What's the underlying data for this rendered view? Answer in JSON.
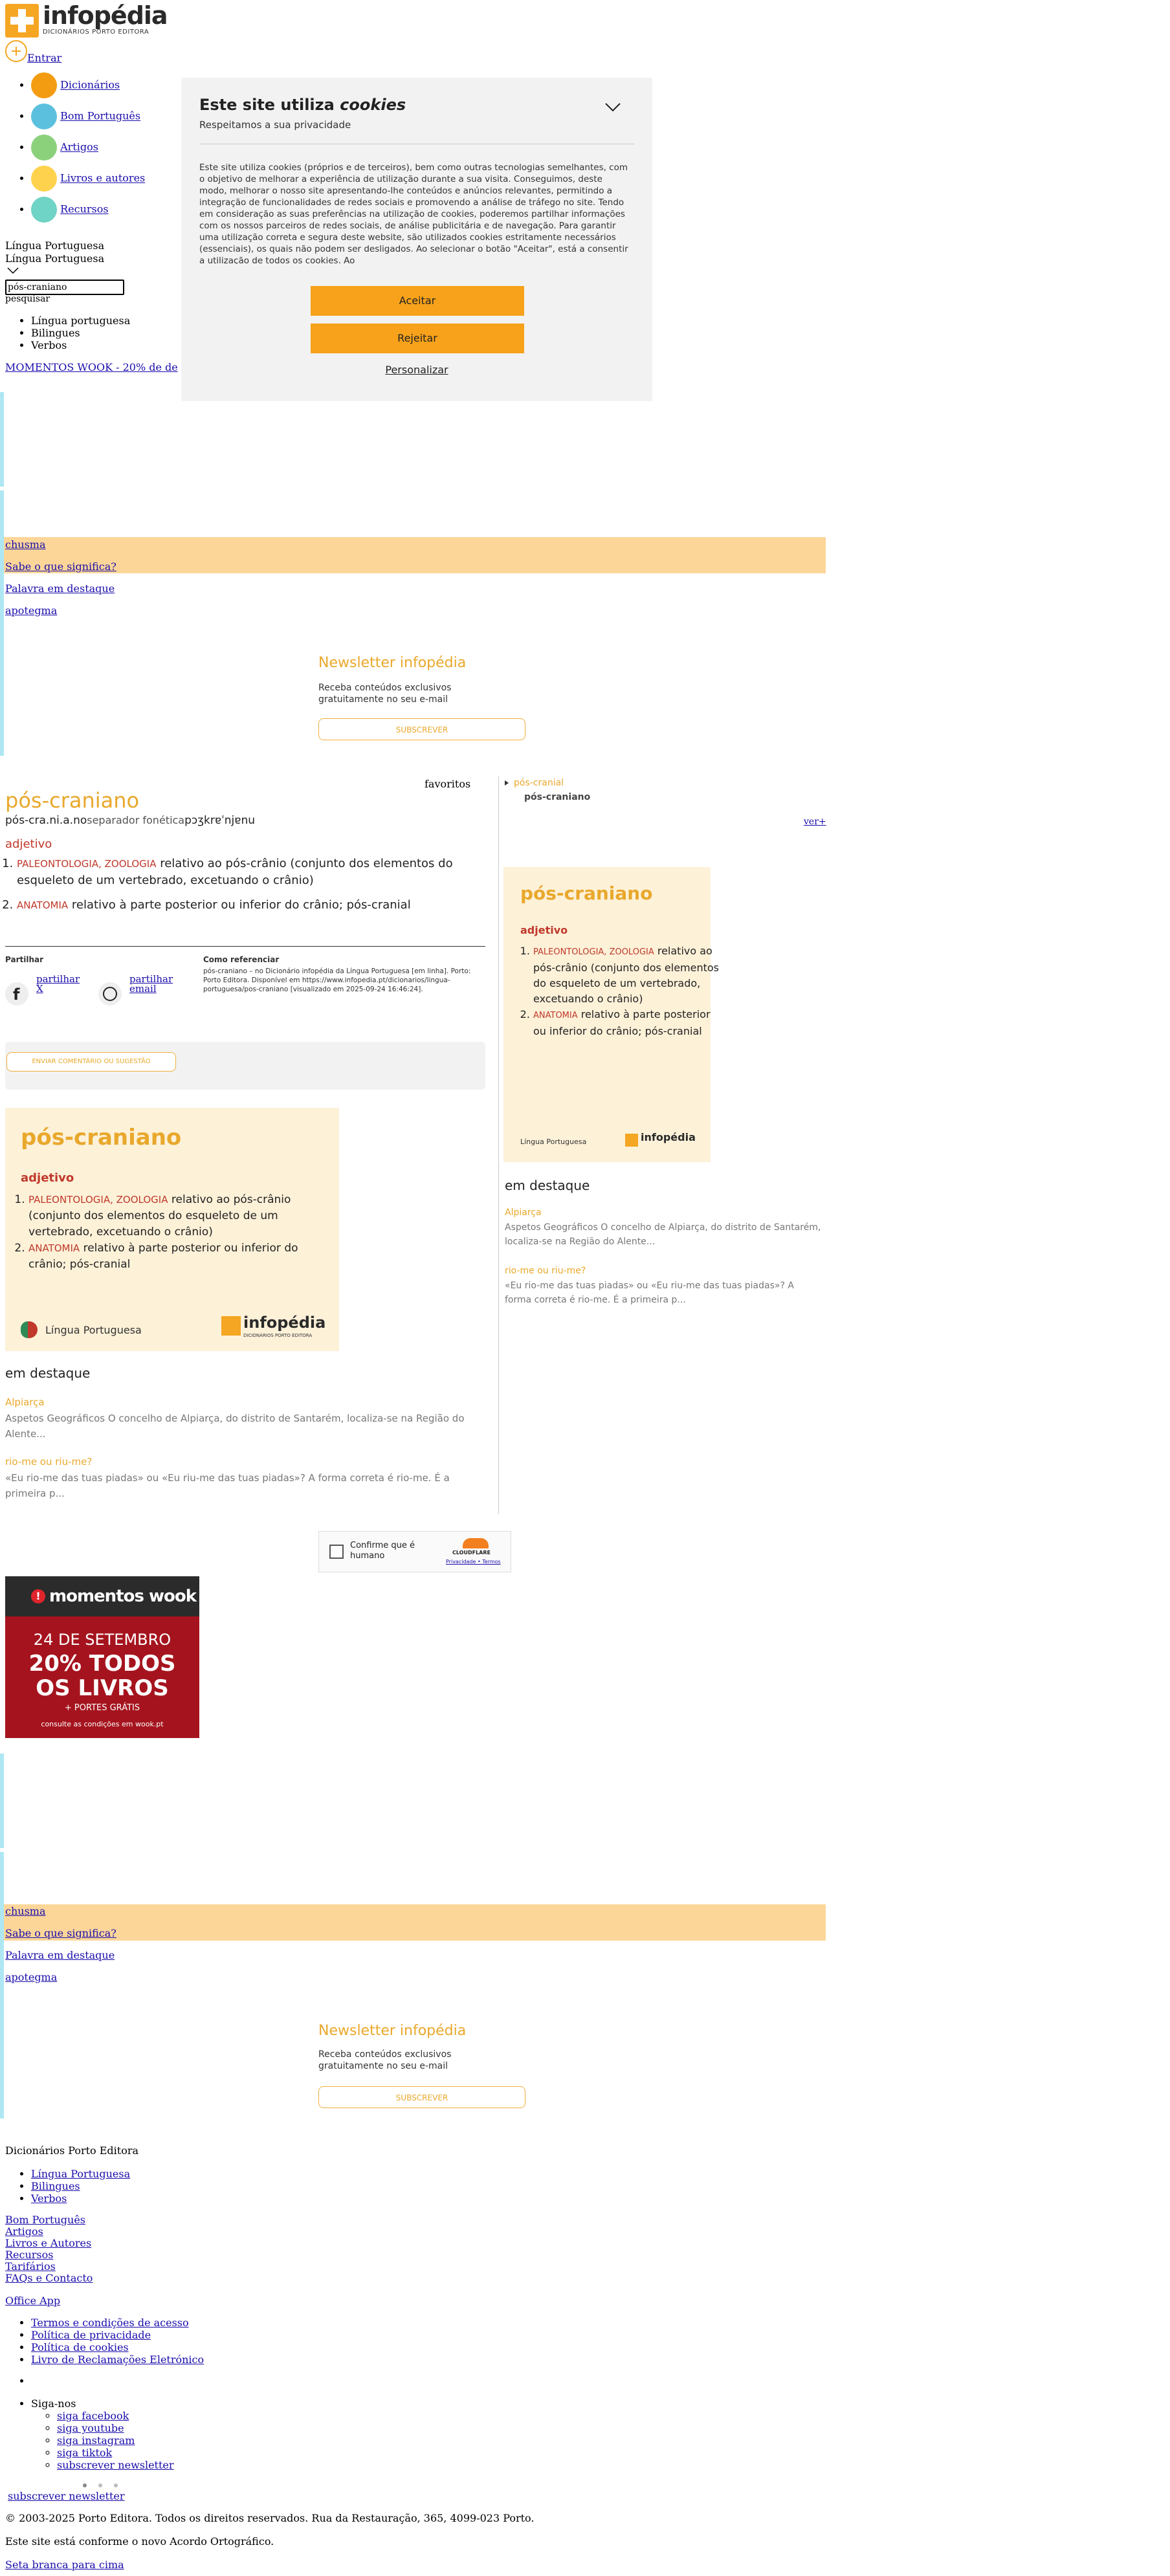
{
  "header": {
    "logo_name": "infopédia",
    "logo_sub": "DICIONÁRIOS PORTO EDITORA",
    "login": "Entrar",
    "nav": [
      "Dicionários",
      "Bom Português",
      "Artigos",
      "Livros e autores",
      "Recursos"
    ],
    "lang1": "Língua Portuguesa",
    "lang2": "Língua Portuguesa",
    "search_value": "pós-craniano",
    "search_alt": "pesquisar",
    "options": [
      "Língua portuguesa",
      "Bilingues",
      "Verbos"
    ],
    "ad_link": "MOMENTOS WOOK - 20% de de"
  },
  "cookie": {
    "title": "Este site utiliza",
    "title_em": "cookies",
    "subtitle": "Respeitamos a sua privacidade",
    "body": "Este site utiliza cookies (próprios e de terceiros), bem como outras tecnologias semelhantes, com o objetivo de melhorar a experiência de utilização durante a sua visita. Conseguimos, deste modo, melhorar o nosso site apresentando-lhe conteúdos e anúncios relevantes, permitindo a integração de funcionalidades de redes sociais e promovendo a análise de tráfego no site. Tendo em consideração as suas preferências na utilização de cookies, poderemos partilhar informações com os nossos parceiros de redes sociais, de análise publicitária e de navegação. Para garantir uma utilização correta e segura deste website, são utilizados cookies estritamente necessários (essenciais), os quais não podem ser desligados. Ao selecionar o botão \"Aceitar\", está a consentir a utilização de todos os cookies. Ao",
    "accept": "Aceitar",
    "reject": "Rejeitar",
    "personalize": "Personalizar"
  },
  "highlight": {
    "word": "chusma",
    "q": "Sabe o que significa?",
    "featured_label": "Palavra em destaque",
    "featured_word": "apotegma"
  },
  "newsletter": {
    "title": "Newsletter infopédia",
    "text": "Receba conteúdos exclusivos gratuitamente no seu e-mail",
    "button": "SUBSCREVER"
  },
  "entry": {
    "title": "pós-craniano",
    "pron_prefix": "pós-cra.ni.a.no",
    "pron_alt": "separador fonética",
    "pron": "pɔʒkrɐˈnjɐnu",
    "fav_alt": "favoritos",
    "gram": "adjetivo",
    "defs": [
      {
        "tag": "PALEONTOLOGIA, ZOOLOGIA",
        "text": "relativo ao pós-crânio (conjunto dos elementos do esqueleto de um vertebrado, excetuando o crânio)"
      },
      {
        "tag": "ANATOMIA",
        "text": "relativo à parte posterior ou inferior do crânio; pós-cranial"
      }
    ]
  },
  "share": {
    "label": "Partilhar",
    "x": "partilhar X",
    "email": "partilhar email",
    "ref_label": "Como referenciar",
    "ref_text": "pós-craniano – no Dicionário infopédia da Língua Portuguesa [em linha]. Porto: Porto Editora. Disponível em https://www.infopedia.pt/dicionarios/lingua-portuguesa/pos-craniano [visualizado em 2025-09-24 16:46:24].",
    "suggest": "ENVIAR COMENTÁRIO OU SUGESTÃO"
  },
  "card": {
    "title": "pós-craniano",
    "gram": "adjetivo",
    "source": "Língua Portuguesa",
    "brand": "infopédia"
  },
  "sidebar": {
    "prev": "pós-cranial",
    "current": "pós-craniano",
    "more": "ver+"
  },
  "featured": {
    "heading": "em destaque",
    "items": [
      {
        "title": "Alpiarça",
        "text": "Aspetos Geográficos O concelho de Alpiarça, do distrito de Santarém, localiza-se na Região do Alente..."
      },
      {
        "title": "rio-me ou riu-me?",
        "text": "«Eu rio-me das tuas piadas» ou «Eu riu-me das tuas piadas»? A forma correta é rio-me. É a primeira p..."
      }
    ]
  },
  "captcha": {
    "label": "Confirme que é humano",
    "brand": "CLOUDFLARE",
    "links": "Privacidade • Termos"
  },
  "ad": {
    "brand": "momentos wook",
    "date": "24 DE SETEMBRO",
    "offer": "20% TODOS OS LIVROS",
    "extra": "+ PORTES GRÁTIS",
    "terms": "consulte as condições em wook.pt"
  },
  "footer": {
    "heading": "Dicionários Porto Editora",
    "dict_links": [
      "Língua Portuguesa",
      "Bilingues",
      "Verbos"
    ],
    "links": [
      "Bom Português",
      "Artigos",
      "Livros e Autores",
      "Recursos",
      "Tarifários",
      "FAQs e Contacto"
    ],
    "office": "Office App",
    "legal": [
      "Termos e condições de acesso",
      "Política de privacidade",
      "Política de cookies",
      "Livro de Reclamações Eletrónico"
    ],
    "follow": "Siga-nos",
    "social": [
      "siga facebook",
      "siga youtube",
      "siga instagram",
      "siga tiktok"
    ],
    "subscribe": "subscrever newsletter",
    "copyright": "© 2003-2025 Porto Editora. Todos os direitos reservados. Rua da Restauração, 365, 4099-023 Porto.",
    "ortho": "Este site está conforme o novo Acordo Ortográfico.",
    "top": "Seta branca para cima"
  },
  "colors": {
    "accent": "#e9a82c",
    "button": "#f7a21a",
    "highlight": "#fcd699",
    "card": "#fdf1d8",
    "strip": "#aee7f3"
  }
}
